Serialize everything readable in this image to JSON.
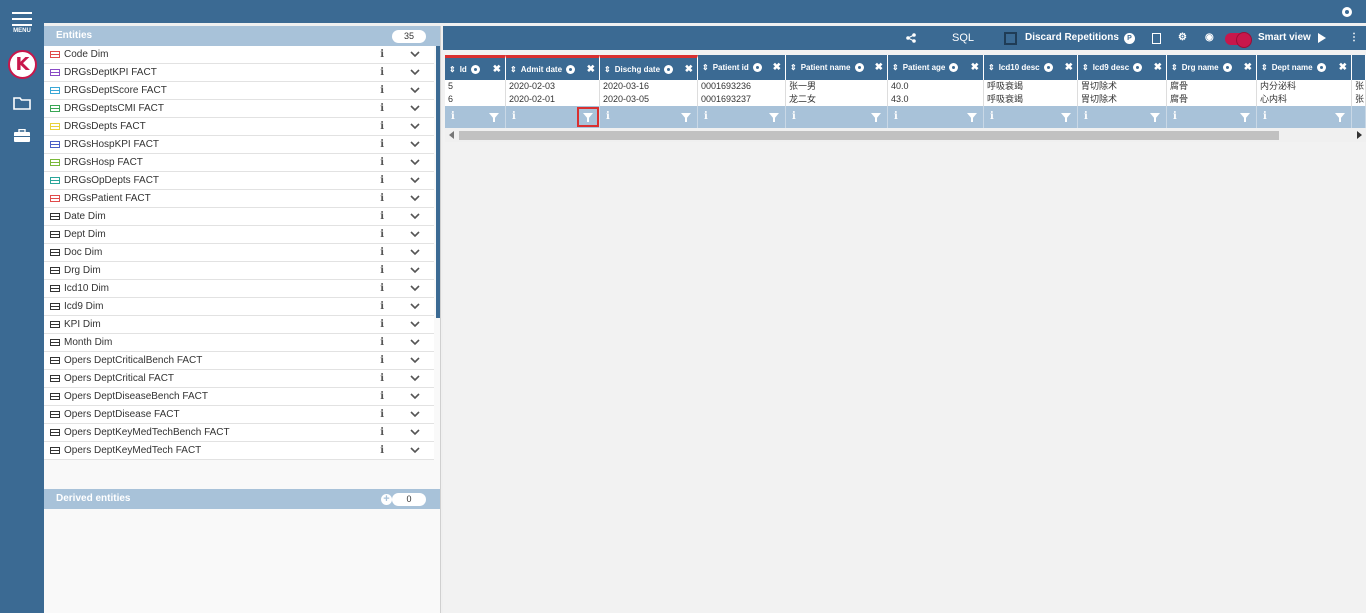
{
  "rail": {
    "menu_label": "MENU",
    "logo_letter": "K",
    "icons": [
      "folder-icon",
      "briefcase-icon"
    ]
  },
  "entities": {
    "title": "Entities",
    "count": "35",
    "items": [
      {
        "label": "Code Dim",
        "icon_color": "#e04b4b"
      },
      {
        "label": "DRGsDeptKPI FACT",
        "icon_color": "#8a4bc6"
      },
      {
        "label": "DRGsDeptScore FACT",
        "icon_color": "#3aa7d6"
      },
      {
        "label": "DRGsDeptsCMI FACT",
        "icon_color": "#3aa655"
      },
      {
        "label": "DRGsDepts FACT",
        "icon_color": "#e8d23a"
      },
      {
        "label": "DRGsHospKPI FACT",
        "icon_color": "#4b5fc6"
      },
      {
        "label": "DRGsHosp FACT",
        "icon_color": "#7ab83a"
      },
      {
        "label": "DRGsOpDepts FACT",
        "icon_color": "#2aa59a"
      },
      {
        "label": "DRGsPatient FACT",
        "icon_color": "#e04b4b"
      },
      {
        "label": "Date Dim",
        "icon_color": "#333333"
      },
      {
        "label": "Dept Dim",
        "icon_color": "#333333"
      },
      {
        "label": "Doc Dim",
        "icon_color": "#333333"
      },
      {
        "label": "Drg Dim",
        "icon_color": "#333333"
      },
      {
        "label": "Icd10 Dim",
        "icon_color": "#333333"
      },
      {
        "label": "Icd9 Dim",
        "icon_color": "#333333"
      },
      {
        "label": "KPI Dim",
        "icon_color": "#333333"
      },
      {
        "label": "Month Dim",
        "icon_color": "#333333"
      },
      {
        "label": "Opers DeptCriticalBench FACT",
        "icon_color": "#333333"
      },
      {
        "label": "Opers DeptCritical FACT",
        "icon_color": "#333333"
      },
      {
        "label": "Opers DeptDiseaseBench FACT",
        "icon_color": "#333333"
      },
      {
        "label": "Opers DeptDisease FACT",
        "icon_color": "#333333"
      },
      {
        "label": "Opers DeptKeyMedTechBench FACT",
        "icon_color": "#333333"
      },
      {
        "label": "Opers DeptKeyMedTech FACT",
        "icon_color": "#333333"
      }
    ],
    "info_glyph": "i"
  },
  "derived": {
    "title": "Derived entities",
    "count": "0"
  },
  "toolbar": {
    "sql_label": "SQL",
    "discard_label": "Discard Repetitions",
    "p_label": "P",
    "smart_view_label": "Smart view",
    "more_label": "⋮"
  },
  "grid": {
    "columns": [
      {
        "label": "Id",
        "highlight": true
      },
      {
        "label": "Admit date",
        "highlight": true
      },
      {
        "label": "Dischg date",
        "highlight": true
      },
      {
        "label": "Patient id",
        "highlight": false
      },
      {
        "label": "Patient name",
        "highlight": false
      },
      {
        "label": "Patient age",
        "highlight": false
      },
      {
        "label": "Icd10 desc",
        "highlight": false
      },
      {
        "label": "Icd9 desc",
        "highlight": false
      },
      {
        "label": "Drg name",
        "highlight": false
      },
      {
        "label": "Dept name",
        "highlight": false
      },
      {
        "label": "",
        "highlight": false
      }
    ],
    "rows": [
      [
        "5",
        "2020-02-03",
        "2020-03-16",
        "0001693236",
        "张一男",
        "40.0",
        "呼吸衰竭",
        "胃切除术",
        "腐骨",
        "内分泌科",
        "张"
      ],
      [
        "6",
        "2020-02-01",
        "2020-03-05",
        "0001693237",
        "龙二女",
        "43.0",
        "呼吸衰竭",
        "胃切除术",
        "腐骨",
        "心内科",
        "张"
      ]
    ]
  }
}
